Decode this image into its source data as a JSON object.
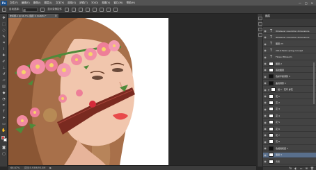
{
  "app": {
    "logo": "Ps"
  },
  "menubar": {
    "items": [
      "文件(F)",
      "编辑(E)",
      "图像(I)",
      "图层(L)",
      "文字(Y)",
      "选择(S)",
      "滤镜(T)",
      "3D(D)",
      "视图(V)",
      "窗口(W)",
      "帮助(H)"
    ],
    "window_controls": [
      "—",
      "□",
      "✕"
    ]
  },
  "options": {
    "labels": [
      "自动选择:",
      "组",
      "显示变换控件"
    ]
  },
  "document": {
    "tab": "未标题-1 @ 66.7% (图层 3, RGB/8) *",
    "close": "×"
  },
  "status": {
    "zoom": "66.67%",
    "doc": "文档:5.93M/93.5M",
    "arrow": "▶"
  },
  "layers_panel": {
    "title": "图层",
    "rows": [
      {
        "name": "Whatever resolution dimensions",
        "kind": "text"
      },
      {
        "name": "Whatever resolution dimensions",
        "kind": "text"
      },
      {
        "name": "图层 23",
        "kind": "text"
      },
      {
        "name": "2019 Hello spring concept",
        "kind": "text"
      },
      {
        "name": "Flower Blossom",
        "kind": "text"
      },
      {
        "name": "图层 2",
        "kind": "pixel"
      },
      {
        "name": "底纹图层",
        "kind": "pixel"
      },
      {
        "name": "色彩平衡调整 1",
        "kind": "adjust"
      },
      {
        "name": "曲线调整 1",
        "kind": "adjust"
      },
      {
        "name": "组 1 · 花环 鲜花",
        "kind": "group"
      },
      {
        "name": "花 1",
        "kind": "pixel"
      },
      {
        "name": "花 2",
        "kind": "pixel"
      },
      {
        "name": "花 3",
        "kind": "pixel"
      },
      {
        "name": "花 4",
        "kind": "pixel"
      },
      {
        "name": "花 5",
        "kind": "pixel"
      },
      {
        "name": "花 6",
        "kind": "pixel"
      },
      {
        "name": "花 7",
        "kind": "pixel"
      },
      {
        "name": "花 8",
        "kind": "pixel"
      },
      {
        "name": "色相饱和度 1",
        "kind": "adjust"
      },
      {
        "name": "图层 3",
        "kind": "pixel"
      },
      {
        "name": "背景",
        "kind": "pixel"
      }
    ],
    "footer_icons": [
      "fx",
      "◐",
      "▭",
      "⊞",
      "🗑"
    ]
  }
}
